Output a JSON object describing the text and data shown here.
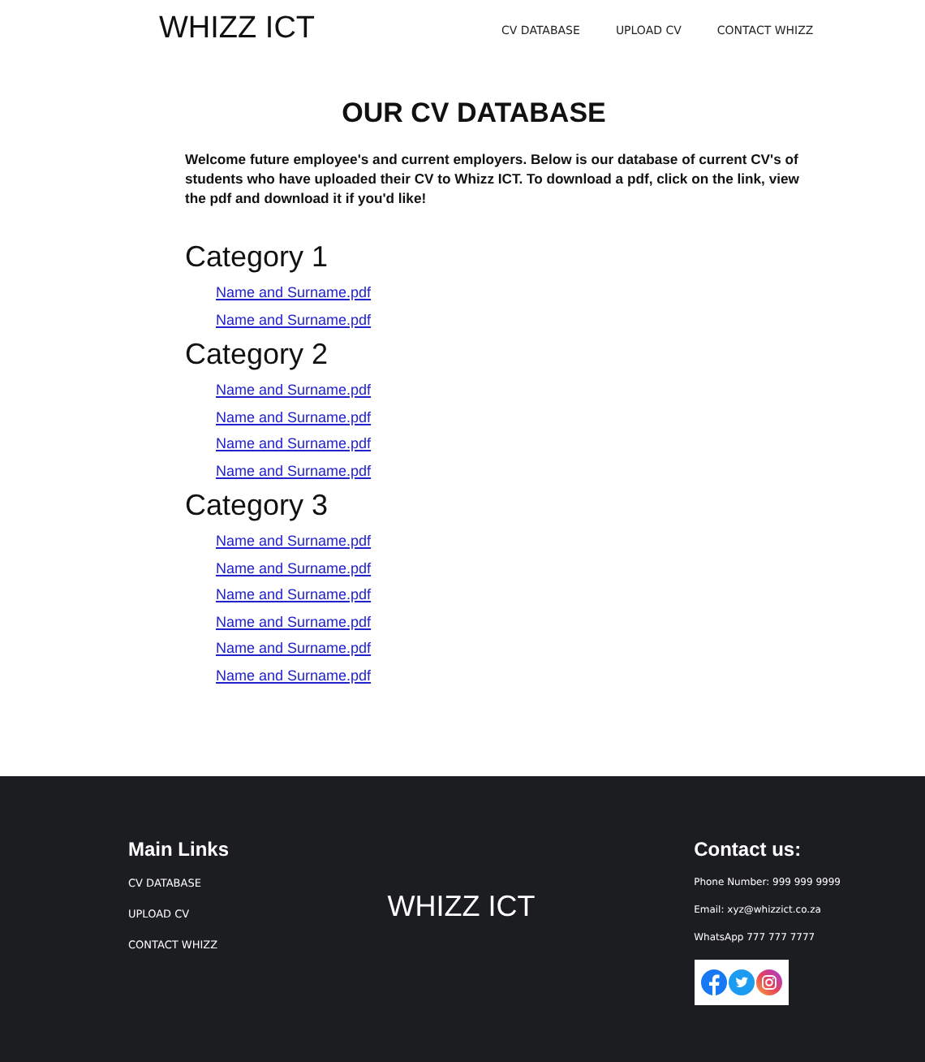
{
  "header": {
    "logo": "WHIZZ ICT",
    "nav": [
      "CV DATABASE",
      "UPLOAD CV",
      "CONTACT WHIZZ"
    ]
  },
  "title": "OUR CV DATABASE",
  "intro": "Welcome future employee's and current employers. Below is our database of current CV's of students who have uploaded their CV to Whizz ICT. To download a pdf, click on the link, view the pdf and download it if you'd like!",
  "categories": [
    {
      "name": "Category 1",
      "files": [
        "Name and Surname.pdf",
        "Name and Surname.pdf"
      ]
    },
    {
      "name": "Category 2",
      "files": [
        "Name and Surname.pdf",
        "Name and Surname.pdf",
        "Name and Surname.pdf",
        "Name and Surname.pdf"
      ]
    },
    {
      "name": "Category 3",
      "files": [
        "Name and Surname.pdf",
        "Name and Surname.pdf",
        "Name and Surname.pdf",
        "Name and Surname.pdf",
        "Name and Surname.pdf",
        "Name and Surname.pdf"
      ]
    }
  ],
  "footer": {
    "links_title": "Main Links",
    "links": [
      "CV DATABASE",
      "UPLOAD CV",
      "CONTACT WHIZZ"
    ],
    "logo": "WHIZZ ICT",
    "contact_title": "Contact us:",
    "contact": [
      "Phone Number: 999 999 9999",
      "Email: xyz@whizzict.co.za",
      "WhatsApp 777 777 7777"
    ]
  }
}
